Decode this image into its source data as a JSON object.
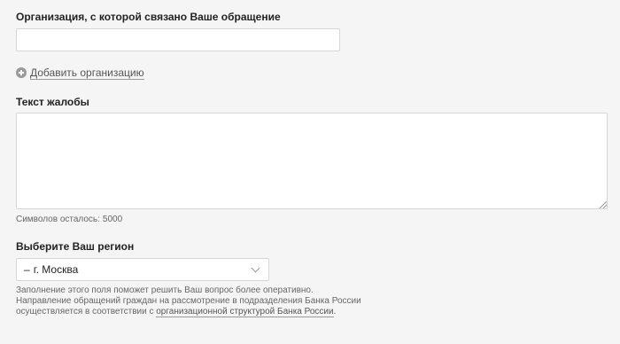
{
  "organization": {
    "label": "Организация, с которой связано Ваше обращение",
    "value": "",
    "add_label": "Добавить организацию"
  },
  "complaint": {
    "label": "Текст жалобы",
    "value": "",
    "counter_label": "Символов осталось:",
    "counter_value": "5000"
  },
  "region": {
    "label": "Выберите Ваш регион",
    "dash": "–",
    "selected": "г. Москва",
    "help_line1": "Заполнение этого поля поможет решить Ваш вопрос более оперативно.",
    "help_line2": "Направление обращений граждан на рассмотрение в подразделения Банка России",
    "help_line3_prefix": "осуществляется в соответствии с ",
    "help_link": "организационной структурой Банка России",
    "help_line3_suffix": "."
  }
}
